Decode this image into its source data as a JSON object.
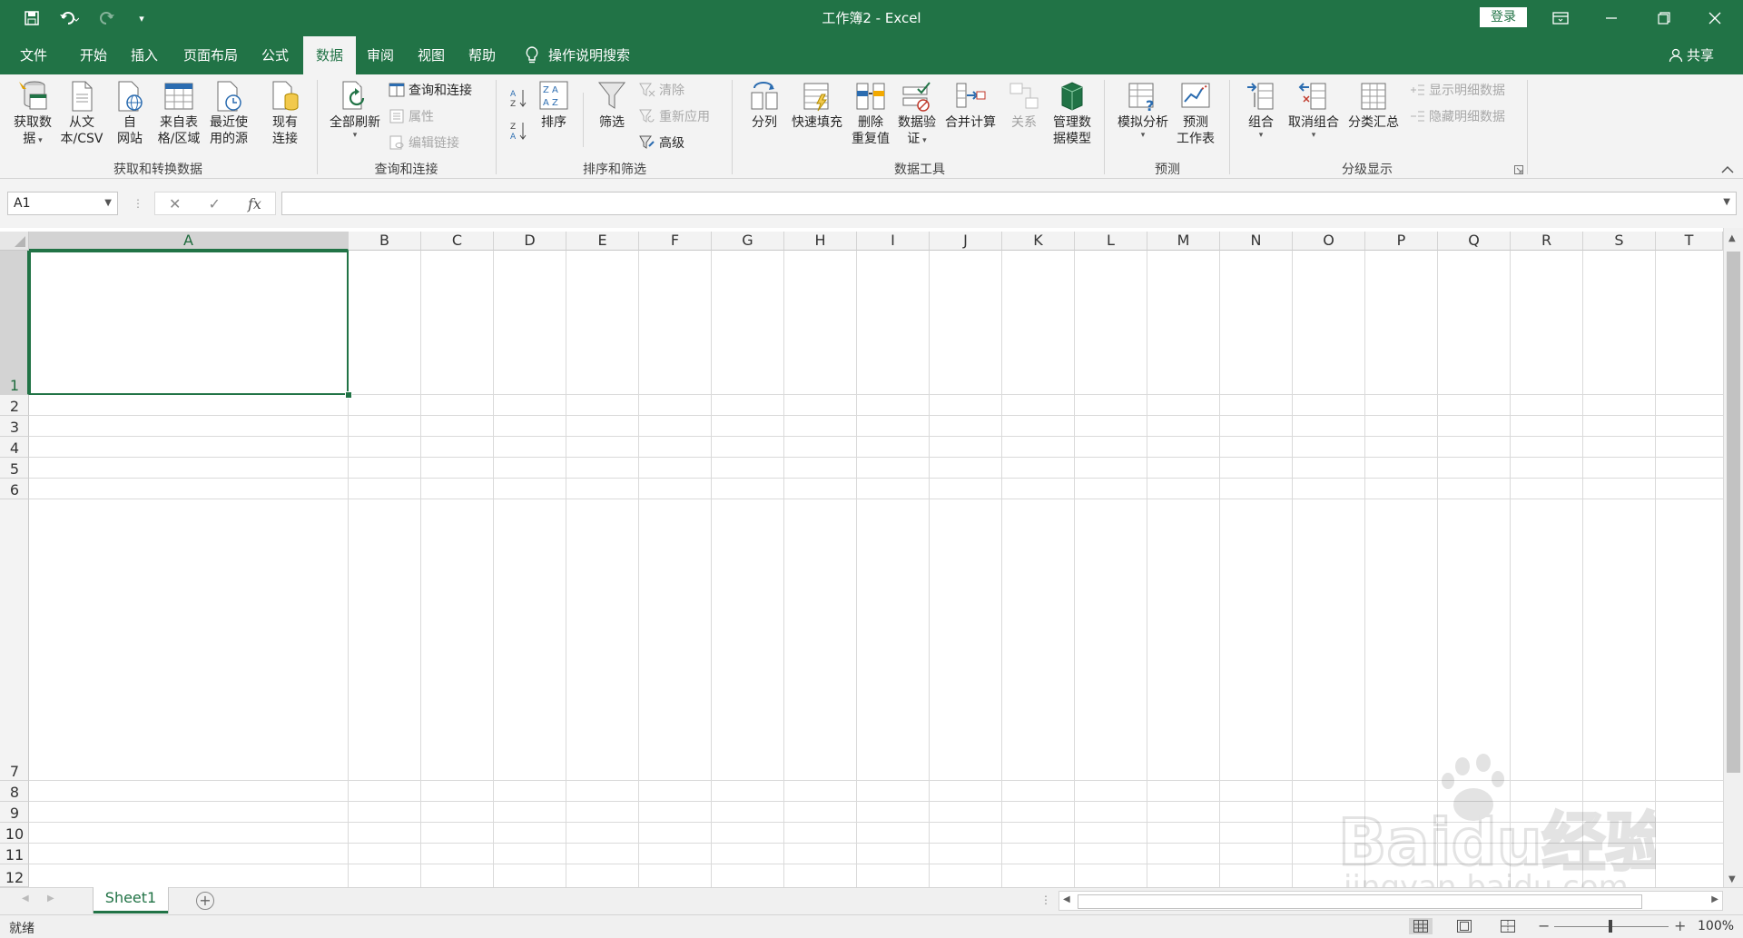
{
  "window": {
    "title": "工作簿2 - Excel",
    "login_label": "登录",
    "share_label": "共享",
    "brand_color": "#217346"
  },
  "quick_access": {
    "icons": [
      "save-icon",
      "undo-icon",
      "redo-icon",
      "customize-icon"
    ]
  },
  "tabs": [
    "文件",
    "开始",
    "插入",
    "页面布局",
    "公式",
    "数据",
    "审阅",
    "视图",
    "帮助"
  ],
  "active_tab": "数据",
  "tell_me": "操作说明搜索",
  "ribbon": {
    "get_transform": {
      "group_label": "获取和转换数据",
      "get_data": [
        "获取数",
        "据"
      ],
      "from_text_csv": [
        "从文",
        "本/CSV"
      ],
      "from_web": [
        "自",
        "网站"
      ],
      "from_table": [
        "来自表",
        "格/区域"
      ],
      "recent_sources": [
        "最近使",
        "用的源"
      ],
      "existing_conn": [
        "现有",
        "连接"
      ]
    },
    "queries": {
      "group_label": "查询和连接",
      "refresh_all": "全部刷新",
      "queries_connections": "查询和连接",
      "properties": "属性",
      "edit_links": "编辑链接"
    },
    "sort_filter": {
      "group_label": "排序和筛选",
      "sort": "排序",
      "filter": "筛选",
      "clear": "清除",
      "reapply": "重新应用",
      "advanced": "高级"
    },
    "data_tools": {
      "group_label": "数据工具",
      "text_to_columns": "分列",
      "flash_fill": "快速填充",
      "remove_duplicates": [
        "删除",
        "重复值"
      ],
      "data_validation": [
        "数据验",
        "证"
      ],
      "consolidate": "合并计算",
      "relationships": "关系",
      "manage_model": [
        "管理数",
        "据模型"
      ]
    },
    "forecast": {
      "group_label": "预测",
      "what_if": "模拟分析",
      "forecast_sheet": [
        "预测",
        "工作表"
      ]
    },
    "outline": {
      "group_label": "分级显示",
      "group": "组合",
      "ungroup": "取消组合",
      "subtotal": "分类汇总",
      "show_detail": "显示明细数据",
      "hide_detail": "隐藏明细数据"
    }
  },
  "formula_bar": {
    "name_box": "A1",
    "formula": "",
    "cancel": "✕",
    "enter": "✓",
    "fx": "fx"
  },
  "grid": {
    "columns": [
      "A",
      "B",
      "C",
      "D",
      "E",
      "F",
      "G",
      "H",
      "I",
      "J",
      "K",
      "L",
      "M",
      "N",
      "O",
      "P",
      "Q",
      "R",
      "S",
      "T"
    ],
    "rows": [
      "1",
      "2",
      "3",
      "4",
      "5",
      "6",
      "7",
      "8",
      "9",
      "10",
      "11",
      "12"
    ],
    "selected_cell": "A1"
  },
  "sheets": [
    "Sheet1"
  ],
  "status": {
    "text": "就绪",
    "zoom_minus": "−",
    "zoom_plus": "+",
    "zoom": "100%"
  },
  "watermark": {
    "brand": "Baidu经验",
    "url": "jingyan.baidu.com"
  }
}
